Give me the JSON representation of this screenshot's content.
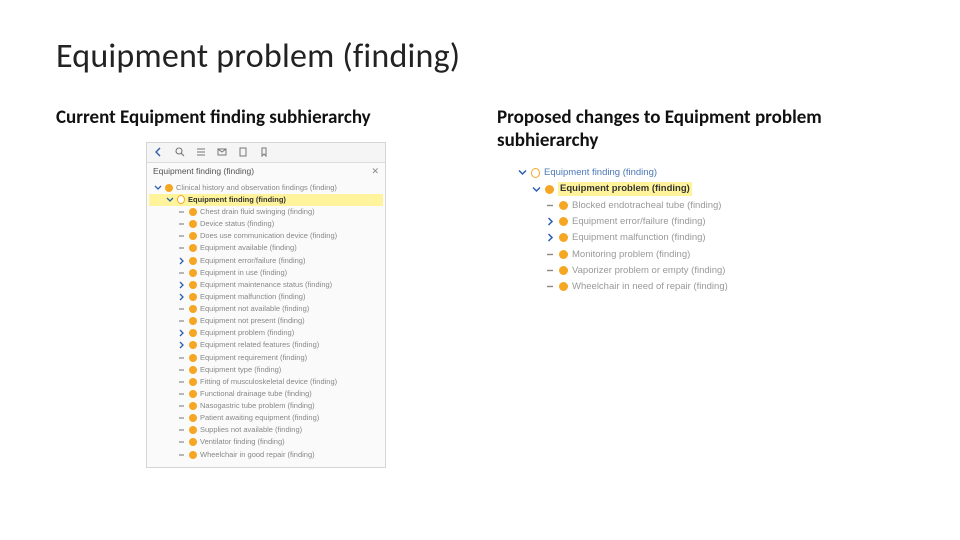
{
  "title": "Equipment problem (finding)",
  "left": {
    "heading": "Current Equipment finding subhierarchy",
    "panelTitle": "Equipment finding (finding)",
    "parent": "Clinical history and observation findings (finding)",
    "root": "Equipment finding (finding)",
    "items": [
      "Chest drain fluid swinging (finding)",
      "Device status (finding)",
      "Does use communication device (finding)",
      "Equipment available (finding)",
      "Equipment error/failure (finding)",
      "Equipment in use (finding)",
      "Equipment maintenance status (finding)",
      "Equipment malfunction (finding)",
      "Equipment not available (finding)",
      "Equipment not present (finding)",
      "Equipment problem (finding)",
      "Equipment related features (finding)",
      "Equipment requirement (finding)",
      "Equipment type (finding)",
      "Fitting of musculoskeletal device (finding)",
      "Functional drainage tube (finding)",
      "Nasogastric tube problem (finding)",
      "Patient awaiting equipment (finding)",
      "Supplies not available (finding)",
      "Ventilator finding (finding)",
      "Wheelchair in good repair (finding)"
    ]
  },
  "right": {
    "heading": "Proposed changes to Equipment problem subhierarchy",
    "root": "Equipment finding (finding)",
    "selected": "Equipment problem (finding)",
    "items": [
      {
        "label": "Blocked endotracheal tube (finding)",
        "expand": "leaf"
      },
      {
        "label": "Equipment error/failure (finding)",
        "expand": "chev"
      },
      {
        "label": "Equipment malfunction (finding)",
        "expand": "chev"
      },
      {
        "label": "Monitoring problem (finding)",
        "expand": "leaf"
      },
      {
        "label": "Vaporizer problem or empty (finding)",
        "expand": "leaf"
      },
      {
        "label": "Wheelchair in need of repair (finding)",
        "expand": "leaf"
      }
    ]
  }
}
